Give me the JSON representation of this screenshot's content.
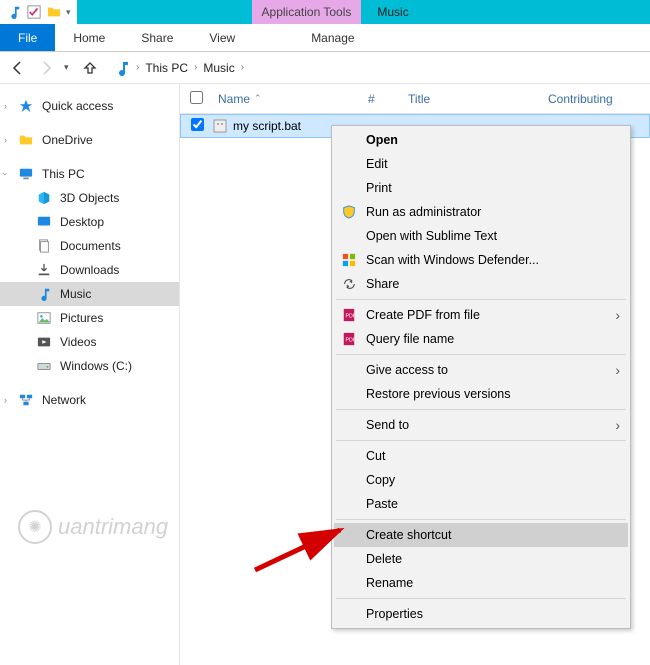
{
  "titlebar": {
    "tools_tab": "Application Tools",
    "title": "Music"
  },
  "ribbon": {
    "file": "File",
    "home": "Home",
    "share": "Share",
    "view": "View",
    "manage": "Manage"
  },
  "breadcrumbs": {
    "this_pc": "This PC",
    "music": "Music"
  },
  "columns": {
    "name": "Name",
    "num": "#",
    "title": "Title",
    "contributing": "Contributing"
  },
  "file": {
    "name": "my script.bat",
    "checked": true
  },
  "sidebar": {
    "quick_access": "Quick access",
    "onedrive": "OneDrive",
    "this_pc": "This PC",
    "objects3d": "3D Objects",
    "desktop": "Desktop",
    "documents": "Documents",
    "downloads": "Downloads",
    "music": "Music",
    "pictures": "Pictures",
    "videos": "Videos",
    "windows_c": "Windows (C:)",
    "network": "Network"
  },
  "context_menu": {
    "open": "Open",
    "edit": "Edit",
    "print": "Print",
    "run_admin": "Run as administrator",
    "open_sublime": "Open with Sublime Text",
    "scan_defender": "Scan with Windows Defender...",
    "share": "Share",
    "create_pdf": "Create PDF from file",
    "query_file": "Query file name",
    "give_access": "Give access to",
    "restore": "Restore previous versions",
    "send_to": "Send to",
    "cut": "Cut",
    "copy": "Copy",
    "paste": "Paste",
    "create_shortcut": "Create shortcut",
    "delete": "Delete",
    "rename": "Rename",
    "properties": "Properties"
  },
  "watermark": "uantrimang"
}
